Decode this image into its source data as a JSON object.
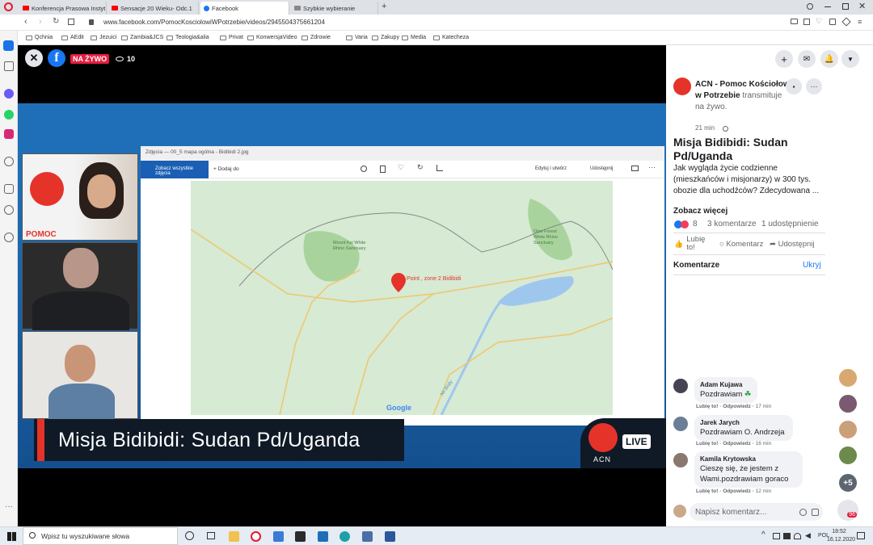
{
  "browser": {
    "tabs": [
      {
        "label": "Konferencja Prasowa Instyt",
        "color": "#ff0000"
      },
      {
        "label": "Sensacje 20 Wieku- Odc.1",
        "color": "#ff0000"
      },
      {
        "label": "Facebook",
        "color": "#1877f2"
      },
      {
        "label": "Szybkie wybieranie",
        "color": "#666666"
      }
    ],
    "url": "www.facebook.com/PomocKosciolowiWPotrzebie/videos/2945504375661204",
    "bookmarks": [
      "Qchnia",
      "AEdit",
      "Jezuici",
      "Zambia&JCS",
      "Teologia&alia",
      "Privat",
      "KonwersjaVideo",
      "Zdrowie",
      "Varia",
      "Zakupy",
      "Media",
      "Katecheza"
    ]
  },
  "video": {
    "live_badge": "NA ŻYWO",
    "viewers": "10",
    "title_overlay": "Misja Bidibidi: Sudan Pd/Uganda",
    "live_label": "LIVE",
    "acn_label": "ACN",
    "window_title": "Zdjęcia — 00_5 mapa ogólna - Bidibidi 2.jpg",
    "toolbar": {
      "all_photos": "Zobacz wszystkie zdjęcia",
      "add": "Dodaj do",
      "edit": "Edytuj i utwórz",
      "share": "Udostępnij"
    },
    "map_pin_label": "Point , zone 2 Bidibidi",
    "map_labels": [
      {
        "text": "Mount Kei White Rhino Sanctuary"
      },
      {
        "text": "Otze Forest White Rhino Sanctuary"
      },
      {
        "text": "Nil Biały"
      },
      {
        "text": "Google"
      }
    ],
    "cam_logo_text": "POMOC"
  },
  "post": {
    "page_name": "ACN - Pomoc Kościołowi w Potrzebie",
    "action": "transmituje na żywo.",
    "time": "21 min",
    "title": "Misja Bidibidi: Sudan Pd/Uganda",
    "description": "Jak wygląda życie codzienne (mieszkańców i misjonarzy) w 300 tys. obozie dla uchodźców? Zdecydowana ...",
    "see_more": "Zobacz więcej",
    "reactions": "8",
    "comments_count": "3 komentarze",
    "shares": "1 udostępnienie",
    "like": "Lubię to!",
    "comment": "Komentarz",
    "share": "Udostępnij",
    "comments_header": "Komentarze",
    "hide": "Ukryj",
    "comments": [
      {
        "author": "Adam Kujawa",
        "text": "Pozdrawiam",
        "like": "Lubię to!",
        "reply": "Odpowiedz",
        "time": "17 min"
      },
      {
        "author": "Jarek Jarych",
        "text": "Pozdrawiam O. Andrzeja",
        "like": "Lubię to!",
        "reply": "Odpowiedz",
        "time": "16 min"
      },
      {
        "author": "Kamila Krytowska",
        "text": "Cieszę się, że jestem z Wami.pozdrawiam goraco",
        "like": "Lubię to!",
        "reply": "Odpowiedz",
        "time": "12 min"
      }
    ],
    "write_placeholder": "Napisz komentarz..."
  },
  "contacts": {
    "more": "+5",
    "count": "96"
  },
  "taskbar": {
    "search_placeholder": "Wpisz tu wyszukiwane słowa",
    "lang": "POL",
    "time": "18:52",
    "date": "16.12.2020"
  },
  "colors": {
    "fb_blue": "#1877f2",
    "live_red": "#e41e3f",
    "acn_red": "#e5332a"
  }
}
